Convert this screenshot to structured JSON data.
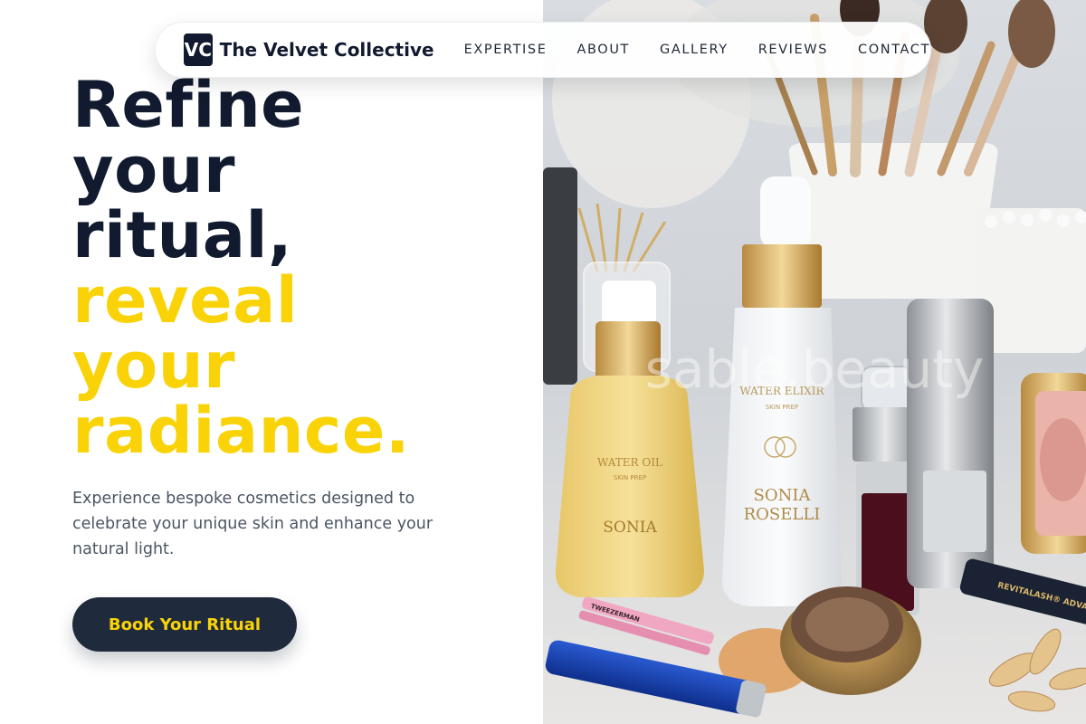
{
  "nav": {
    "logo_mark": "VC",
    "brand_name": "The Velvet Collective",
    "links": [
      "EXPERTISE",
      "ABOUT",
      "GALLERY",
      "REVIEWS",
      "CONTACT"
    ]
  },
  "hero": {
    "headline_lines": [
      "Refine",
      "your",
      "ritual,"
    ],
    "accent_lines": [
      "reveal",
      "your",
      "radiance."
    ],
    "subtext": "Experience bespoke cosmetics designed to celebrate your unique skin and enhance your natural light.",
    "cta_label": "Book Your Ritual"
  },
  "image": {
    "watermark": "sable.beauty",
    "label_water_oil": "WATER OIL",
    "label_skin_prep": "SKIN PREP",
    "label_sonia": "SONIA",
    "label_roselli": "ROSELLI",
    "label_water_elixir": "WATER ELIXIR",
    "label_tweezerman": "TWEEZERMAN",
    "label_revitalash": "REVITALASH® ADVANCED"
  },
  "colors": {
    "navy": "#111a2e",
    "accent_yellow": "#f9d308",
    "button_bg": "#1f2a3c",
    "body_text": "#4b5563"
  }
}
